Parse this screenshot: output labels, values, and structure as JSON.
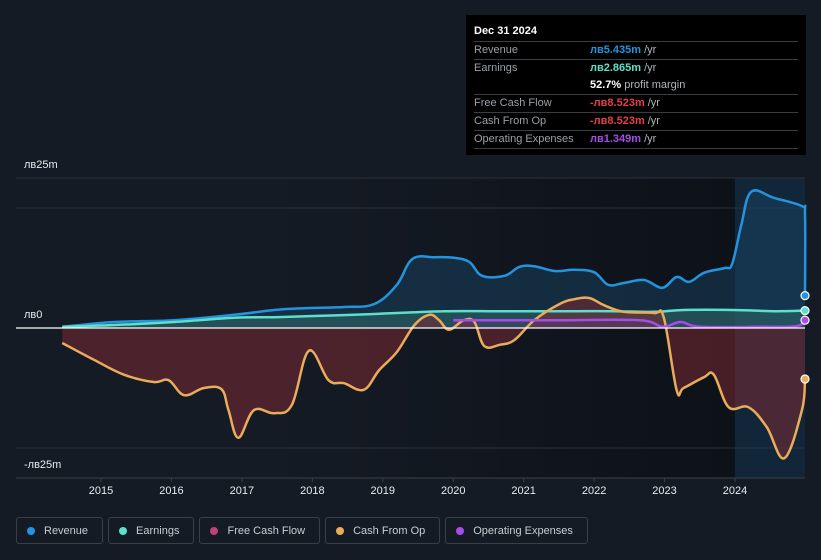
{
  "tooltip": {
    "date": "Dec 31 2024",
    "rows": [
      {
        "label": "Revenue",
        "value": "лв5.435m",
        "unit": "/yr",
        "color": "#2394df"
      },
      {
        "label": "Earnings",
        "value": "лв2.865m",
        "unit": "/yr",
        "color": "#5ce0cb"
      },
      {
        "label": "",
        "value": "52.7%",
        "unit": "profit margin",
        "color": "#ffffff"
      },
      {
        "label": "Free Cash Flow",
        "value": "-лв8.523m",
        "unit": "/yr",
        "color": "#e5404a"
      },
      {
        "label": "Cash From Op",
        "value": "-лв8.523m",
        "unit": "/yr",
        "color": "#e5404a"
      },
      {
        "label": "Operating Expenses",
        "value": "лв1.349m",
        "unit": "/yr",
        "color": "#a64de8"
      }
    ]
  },
  "legend": [
    {
      "label": "Revenue",
      "color": "#2394df"
    },
    {
      "label": "Earnings",
      "color": "#5ce0cb"
    },
    {
      "label": "Free Cash Flow",
      "color": "#c2407a"
    },
    {
      "label": "Cash From Op",
      "color": "#e8ac5a"
    },
    {
      "label": "Operating Expenses",
      "color": "#a64de8"
    }
  ],
  "chart_data": {
    "type": "line",
    "title": "",
    "xlabel": "",
    "ylabel": "",
    "currency": "лв",
    "unit": "m",
    "ylim": [
      -25,
      25
    ],
    "xlim": [
      2014.0,
      2025.0
    ],
    "y_tick_labels": [
      {
        "value": 25,
        "label": "лв25m"
      },
      {
        "value": 0,
        "label": "лв0"
      },
      {
        "value": -25,
        "label": "-лв25m"
      }
    ],
    "x_tick_labels": [
      "2015",
      "2016",
      "2017",
      "2018",
      "2019",
      "2020",
      "2021",
      "2022",
      "2023",
      "2024"
    ],
    "x_ticks": [
      2015,
      2016,
      2017,
      2018,
      2019,
      2020,
      2021,
      2022,
      2023,
      2024
    ],
    "highlight_from": 2024.0,
    "grid": true,
    "legend_position": "bottom",
    "series": [
      {
        "name": "Revenue",
        "color": "#2394df",
        "x": [
          2014.45,
          2015.19,
          2016.04,
          2016.89,
          2017.46,
          2017.88,
          2018.45,
          2018.88,
          2019.2,
          2019.42,
          2019.73,
          2020.01,
          2020.23,
          2020.41,
          2020.73,
          2020.94,
          2021.15,
          2021.44,
          2021.72,
          2022.0,
          2022.2,
          2022.42,
          2022.71,
          2022.97,
          2023.17,
          2023.35,
          2023.56,
          2023.85,
          2023.96,
          2024.09,
          2024.23,
          2024.55,
          2024.95,
          2025.04,
          2025.19
        ],
        "values": [
          0.2,
          1.0,
          1.3,
          2.2,
          3.0,
          3.3,
          3.5,
          4.0,
          7.2,
          11.5,
          11.8,
          11.7,
          11.0,
          8.7,
          8.7,
          10.2,
          10.3,
          9.5,
          9.7,
          9.3,
          7.2,
          7.5,
          8.0,
          6.7,
          8.5,
          7.7,
          9.2,
          10.0,
          10.7,
          17.2,
          22.7,
          21.7,
          20.3,
          18.8,
          5.4
        ]
      },
      {
        "name": "Earnings",
        "color": "#5ce0cb",
        "x": [
          2014.45,
          2015.19,
          2016.04,
          2016.89,
          2017.46,
          2018.02,
          2018.59,
          2019.2,
          2019.87,
          2020.58,
          2021.15,
          2021.72,
          2022.28,
          2022.85,
          2023.27,
          2023.98,
          2024.55,
          2025.19
        ],
        "values": [
          0.2,
          0.5,
          1.0,
          1.7,
          1.8,
          2.0,
          2.2,
          2.5,
          2.8,
          2.8,
          2.8,
          2.8,
          2.8,
          2.7,
          3.0,
          3.0,
          2.8,
          2.9
        ]
      },
      {
        "name": "Free Cash Flow",
        "color": "#c2407a",
        "x": [
          2014.45,
          2014.9,
          2015.33,
          2015.75,
          2015.96,
          2016.18,
          2016.46,
          2016.71,
          2016.81,
          2016.95,
          2017.17,
          2017.46,
          2017.71,
          2017.95,
          2018.23,
          2018.45,
          2018.73,
          2018.95,
          2019.2,
          2019.45,
          2019.66,
          2019.8,
          2019.94,
          2020.15,
          2020.3,
          2020.44,
          2020.66,
          2020.87,
          2021.15,
          2021.51,
          2021.72,
          2021.93,
          2022.14,
          2022.42,
          2022.85,
          2022.99,
          2023.17,
          2023.27,
          2023.56,
          2023.7,
          2023.91,
          2024.19,
          2024.45,
          2024.7,
          2024.95,
          2025.19
        ],
        "values": [
          -2.5,
          -5.3,
          -7.8,
          -9.0,
          -8.7,
          -11.2,
          -10.0,
          -10.2,
          -13.7,
          -18.3,
          -13.7,
          -14.2,
          -12.8,
          -3.8,
          -8.7,
          -9.2,
          -10.3,
          -7.0,
          -4.0,
          0.5,
          2.2,
          1.3,
          -0.3,
          1.3,
          1.0,
          -3.0,
          -2.8,
          -2.0,
          1.3,
          4.0,
          4.8,
          5.0,
          3.8,
          2.7,
          2.5,
          1.7,
          -10.3,
          -10.0,
          -8.2,
          -7.8,
          -13.2,
          -13.2,
          -16.5,
          -21.7,
          -13.7,
          -8.5
        ]
      },
      {
        "name": "Cash From Op",
        "color": "#e8ac5a",
        "x": [
          2014.45,
          2014.9,
          2015.33,
          2015.75,
          2015.96,
          2016.18,
          2016.46,
          2016.71,
          2016.81,
          2016.95,
          2017.17,
          2017.46,
          2017.71,
          2017.95,
          2018.23,
          2018.45,
          2018.73,
          2018.95,
          2019.2,
          2019.45,
          2019.66,
          2019.8,
          2019.94,
          2020.15,
          2020.3,
          2020.44,
          2020.66,
          2020.87,
          2021.15,
          2021.51,
          2021.72,
          2021.93,
          2022.14,
          2022.42,
          2022.85,
          2022.99,
          2023.17,
          2023.27,
          2023.56,
          2023.7,
          2023.91,
          2024.19,
          2024.45,
          2024.7,
          2024.95,
          2025.19
        ],
        "values": [
          -2.5,
          -5.3,
          -7.8,
          -9.0,
          -8.7,
          -11.2,
          -10.0,
          -10.2,
          -13.7,
          -18.3,
          -13.7,
          -14.2,
          -12.8,
          -3.8,
          -8.7,
          -9.2,
          -10.3,
          -7.0,
          -4.0,
          0.5,
          2.2,
          1.3,
          -0.3,
          1.3,
          1.0,
          -3.0,
          -2.8,
          -2.0,
          1.3,
          4.0,
          4.8,
          5.0,
          3.8,
          2.7,
          2.5,
          1.7,
          -10.3,
          -10.0,
          -8.2,
          -7.8,
          -13.2,
          -13.2,
          -16.5,
          -21.7,
          -13.7,
          -8.5
        ]
      },
      {
        "name": "Operating Expenses",
        "color": "#a64de8",
        "x": [
          2020.0,
          2020.66,
          2021.51,
          2022.65,
          2022.97,
          2023.23,
          2023.51,
          2024.37,
          2024.87,
          2025.19
        ],
        "values": [
          1.3,
          1.3,
          1.3,
          1.3,
          0.2,
          1.0,
          0.2,
          0.2,
          0.3,
          1.3
        ]
      }
    ]
  }
}
